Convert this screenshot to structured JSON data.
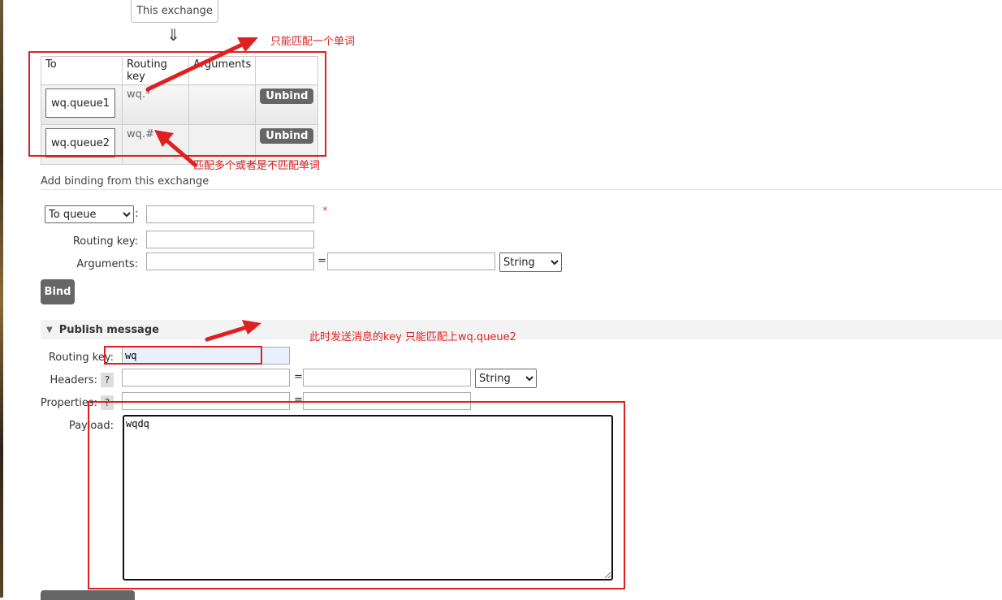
{
  "exchange_box": {
    "label": "This exchange"
  },
  "down_arrow": "⇓",
  "bindings": {
    "headers": [
      "To",
      "Routing key",
      "Arguments",
      ""
    ],
    "rows": [
      {
        "to": "wq.queue1",
        "routing_key": "wq.*",
        "arguments": "",
        "action": "Unbind"
      },
      {
        "to": "wq.queue2",
        "routing_key": "wq.#",
        "arguments": "",
        "action": "Unbind"
      }
    ]
  },
  "add_binding": {
    "title": "Add binding from this exchange",
    "destination_type": "To queue",
    "destination_value": "",
    "required_mark": "*",
    "routing_key_label": "Routing key:",
    "routing_key_value": "",
    "arguments_label": "Arguments:",
    "argument_key": "",
    "argument_value": "",
    "equals": "=",
    "argument_type": "String",
    "bind_button": "Bind",
    "colon": ":"
  },
  "publish": {
    "title": "Publish message",
    "routing_key_label": "Routing key:",
    "routing_key_value": "wq",
    "headers_label": "Headers:",
    "header_key": "",
    "header_value": "",
    "header_type": "String",
    "properties_label": "Properties:",
    "property_key": "",
    "property_value": "",
    "payload_label": "Payload:",
    "payload_value": "wqdq",
    "help": "?",
    "equals": "="
  },
  "annotations": {
    "single_word": "只能匹配一个单词",
    "multi_word": "匹配多个或者是不匹配单词",
    "publish_note": "此时发送消息的key 只能匹配上wq.queue2"
  },
  "colors": {
    "annotation_red": "#e02020",
    "button_gray": "#666666"
  }
}
